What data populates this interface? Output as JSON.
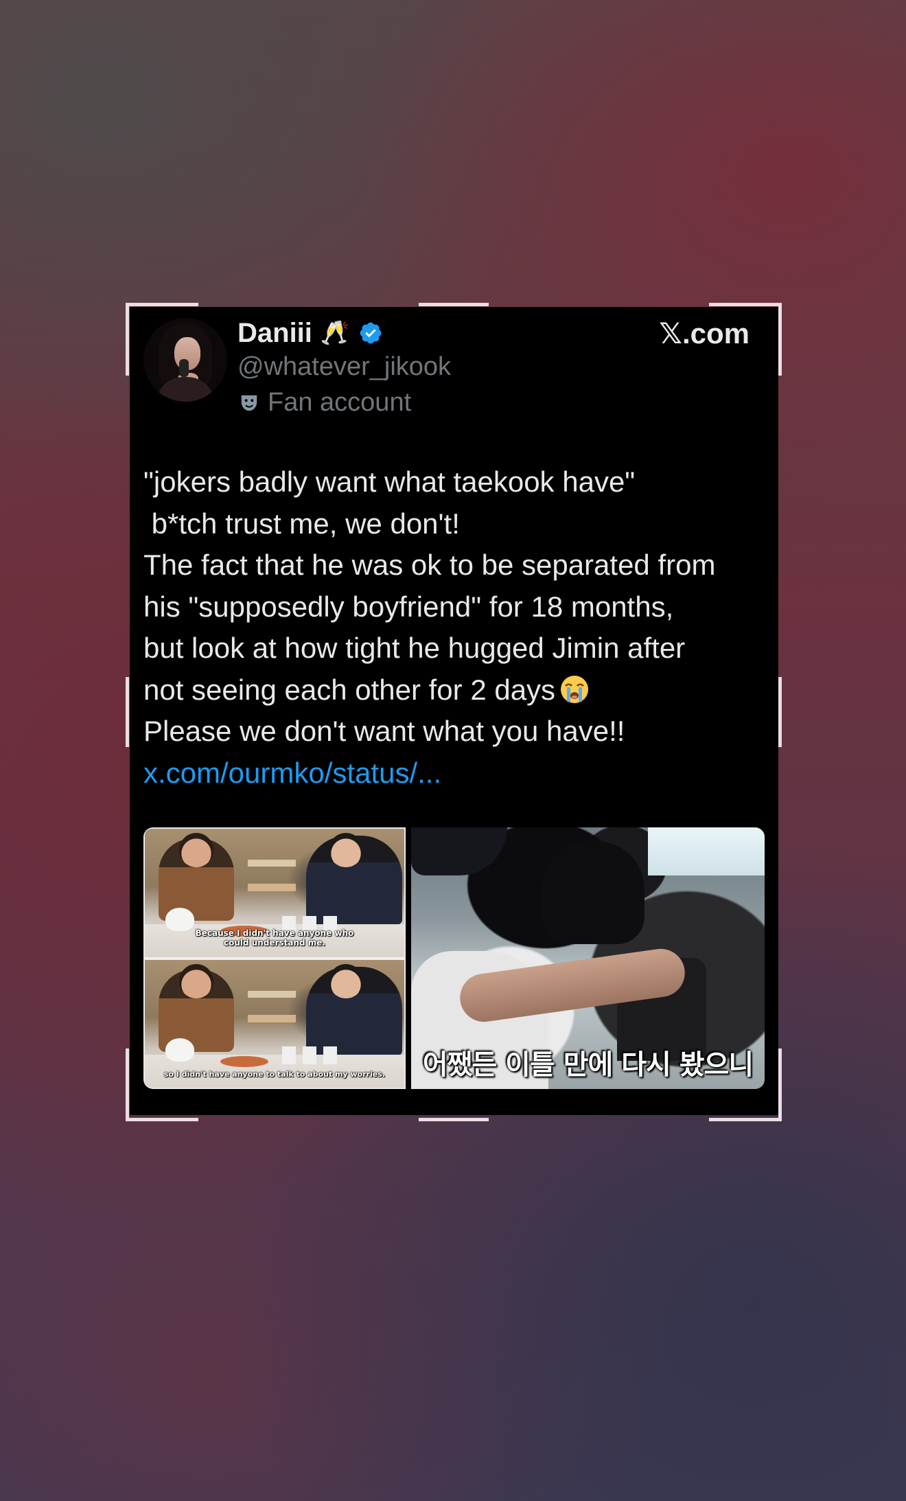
{
  "tweet": {
    "display_name": "Daniii",
    "name_emoji": "🥂",
    "handle": "@whatever_jikook",
    "account_label": "Fan account",
    "brand": "𝕏.com",
    "text_lines": [
      "\"jokers badly want what taekook have\"",
      " b*tch trust me, we don't!",
      "The fact that he was ok to be separated from",
      "his \"supposedly boyfriend\" for 18 months,",
      "but look at how tight he hugged Jimin after",
      "not seeing each other for 2 days",
      "Please we don't want what you have!!"
    ],
    "link": "x.com/ourmko/status/...",
    "media": {
      "left_top_subtitle": "Because I didn't have anyone who could understand me.",
      "left_bottom_subtitle": "so I didn't have anyone to talk to about my worries.",
      "right_subtitle": "어쨌든 이틀 만에 다시 봤으니"
    }
  },
  "icons": {
    "verified": "verified-badge-icon",
    "mask": "theater-mask-icon",
    "crying": "loudly-crying-face-icon"
  },
  "colors": {
    "card_background": "#000000",
    "primary_text": "#e7e9ea",
    "secondary_text": "#71767b",
    "link": "#1d9bf0",
    "verified": "#1d9bf0"
  }
}
